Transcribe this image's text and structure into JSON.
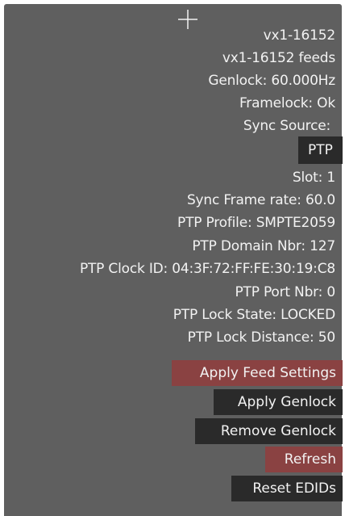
{
  "panel": {
    "device_name": "vx1-16152",
    "feeds_title": "vx1-16152 feeds",
    "genlock": "Genlock: 60.000Hz",
    "framelock": "Framelock: Ok",
    "sync_source_label": "Sync Source:",
    "sync_source_value": "PTP",
    "slot": "Slot: 1",
    "sync_frame_rate": "Sync Frame rate: 60.0",
    "ptp_profile": "PTP Profile: SMPTE2059",
    "ptp_domain": "PTP Domain Nbr: 127",
    "ptp_clock_id": "PTP Clock ID: 04:3F:72:FF:FE:30:19:C8",
    "ptp_port": "PTP Port Nbr: 0",
    "ptp_lock_state": "PTP Lock State: LOCKED",
    "ptp_lock_distance": "PTP Lock Distance: 50"
  },
  "actions": {
    "apply_feed_settings": "Apply Feed Settings",
    "apply_genlock": "Apply Genlock",
    "remove_genlock": "Remove Genlock",
    "refresh": "Refresh",
    "reset_edids": "Reset EDIDs"
  },
  "colors": {
    "panel_bg": "#5f5f5f",
    "dark_button": "#2a2a2a",
    "red_button": "#8a4242",
    "text": "#f2f2f2"
  },
  "icons": {
    "crosshair": "crosshair-icon"
  }
}
